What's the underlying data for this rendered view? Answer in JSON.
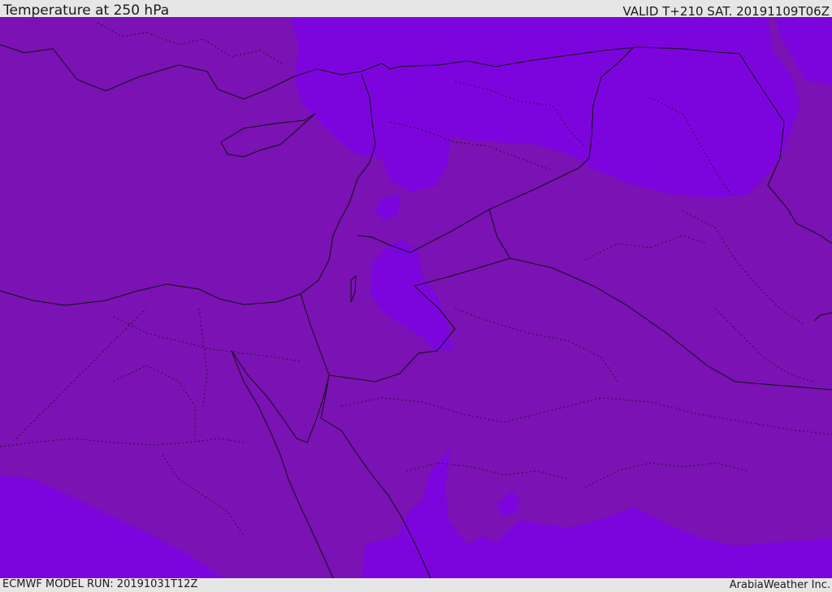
{
  "header": {
    "title": "Temperature at 250 hPa",
    "valid": "VALID T+210 SAT. 20191109T06Z"
  },
  "footer": {
    "model_run": "ECMWF MODEL RUN: 20191031T12Z",
    "credit": "ArabiaWeather Inc."
  },
  "colors": {
    "base_field": "#7a12b4",
    "cold_field": "#7c05dd",
    "border": "#111111",
    "header_bg": "#e6e6e6"
  },
  "map": {
    "variable": "Temperature at 250 hPa",
    "region": "Eastern Mediterranean / Middle East"
  }
}
